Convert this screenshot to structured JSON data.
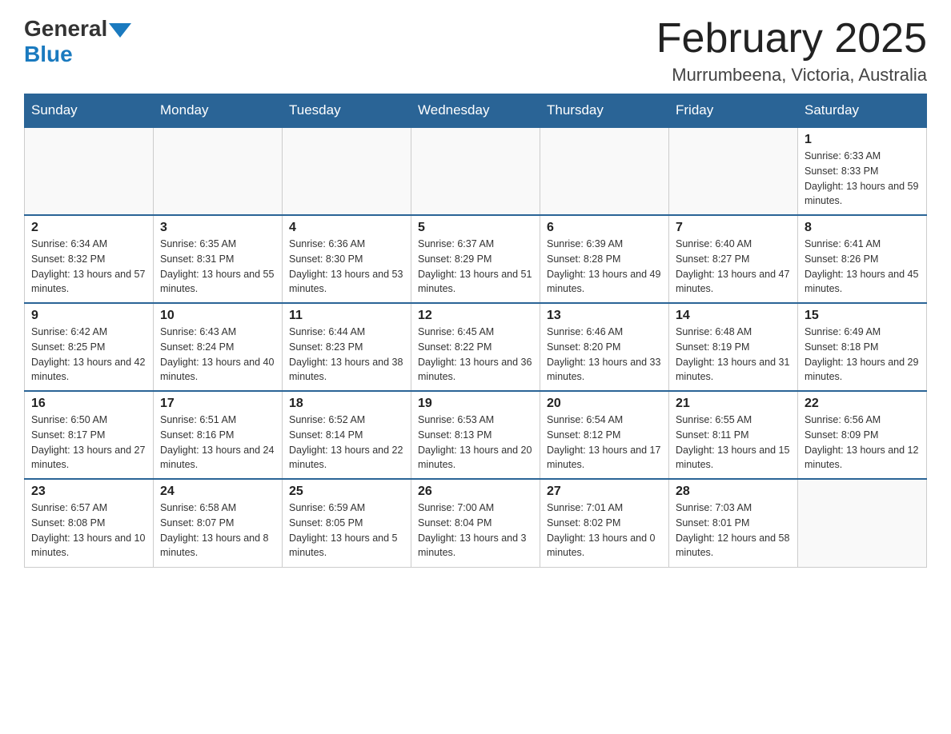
{
  "header": {
    "logo": {
      "general": "General",
      "blue": "Blue",
      "arrow_color": "#1a7abf"
    },
    "title": "February 2025",
    "location": "Murrumbeena, Victoria, Australia"
  },
  "calendar": {
    "days_of_week": [
      "Sunday",
      "Monday",
      "Tuesday",
      "Wednesday",
      "Thursday",
      "Friday",
      "Saturday"
    ],
    "weeks": [
      [
        {
          "day": "",
          "info": ""
        },
        {
          "day": "",
          "info": ""
        },
        {
          "day": "",
          "info": ""
        },
        {
          "day": "",
          "info": ""
        },
        {
          "day": "",
          "info": ""
        },
        {
          "day": "",
          "info": ""
        },
        {
          "day": "1",
          "info": "Sunrise: 6:33 AM\nSunset: 8:33 PM\nDaylight: 13 hours and 59 minutes."
        }
      ],
      [
        {
          "day": "2",
          "info": "Sunrise: 6:34 AM\nSunset: 8:32 PM\nDaylight: 13 hours and 57 minutes."
        },
        {
          "day": "3",
          "info": "Sunrise: 6:35 AM\nSunset: 8:31 PM\nDaylight: 13 hours and 55 minutes."
        },
        {
          "day": "4",
          "info": "Sunrise: 6:36 AM\nSunset: 8:30 PM\nDaylight: 13 hours and 53 minutes."
        },
        {
          "day": "5",
          "info": "Sunrise: 6:37 AM\nSunset: 8:29 PM\nDaylight: 13 hours and 51 minutes."
        },
        {
          "day": "6",
          "info": "Sunrise: 6:39 AM\nSunset: 8:28 PM\nDaylight: 13 hours and 49 minutes."
        },
        {
          "day": "7",
          "info": "Sunrise: 6:40 AM\nSunset: 8:27 PM\nDaylight: 13 hours and 47 minutes."
        },
        {
          "day": "8",
          "info": "Sunrise: 6:41 AM\nSunset: 8:26 PM\nDaylight: 13 hours and 45 minutes."
        }
      ],
      [
        {
          "day": "9",
          "info": "Sunrise: 6:42 AM\nSunset: 8:25 PM\nDaylight: 13 hours and 42 minutes."
        },
        {
          "day": "10",
          "info": "Sunrise: 6:43 AM\nSunset: 8:24 PM\nDaylight: 13 hours and 40 minutes."
        },
        {
          "day": "11",
          "info": "Sunrise: 6:44 AM\nSunset: 8:23 PM\nDaylight: 13 hours and 38 minutes."
        },
        {
          "day": "12",
          "info": "Sunrise: 6:45 AM\nSunset: 8:22 PM\nDaylight: 13 hours and 36 minutes."
        },
        {
          "day": "13",
          "info": "Sunrise: 6:46 AM\nSunset: 8:20 PM\nDaylight: 13 hours and 33 minutes."
        },
        {
          "day": "14",
          "info": "Sunrise: 6:48 AM\nSunset: 8:19 PM\nDaylight: 13 hours and 31 minutes."
        },
        {
          "day": "15",
          "info": "Sunrise: 6:49 AM\nSunset: 8:18 PM\nDaylight: 13 hours and 29 minutes."
        }
      ],
      [
        {
          "day": "16",
          "info": "Sunrise: 6:50 AM\nSunset: 8:17 PM\nDaylight: 13 hours and 27 minutes."
        },
        {
          "day": "17",
          "info": "Sunrise: 6:51 AM\nSunset: 8:16 PM\nDaylight: 13 hours and 24 minutes."
        },
        {
          "day": "18",
          "info": "Sunrise: 6:52 AM\nSunset: 8:14 PM\nDaylight: 13 hours and 22 minutes."
        },
        {
          "day": "19",
          "info": "Sunrise: 6:53 AM\nSunset: 8:13 PM\nDaylight: 13 hours and 20 minutes."
        },
        {
          "day": "20",
          "info": "Sunrise: 6:54 AM\nSunset: 8:12 PM\nDaylight: 13 hours and 17 minutes."
        },
        {
          "day": "21",
          "info": "Sunrise: 6:55 AM\nSunset: 8:11 PM\nDaylight: 13 hours and 15 minutes."
        },
        {
          "day": "22",
          "info": "Sunrise: 6:56 AM\nSunset: 8:09 PM\nDaylight: 13 hours and 12 minutes."
        }
      ],
      [
        {
          "day": "23",
          "info": "Sunrise: 6:57 AM\nSunset: 8:08 PM\nDaylight: 13 hours and 10 minutes."
        },
        {
          "day": "24",
          "info": "Sunrise: 6:58 AM\nSunset: 8:07 PM\nDaylight: 13 hours and 8 minutes."
        },
        {
          "day": "25",
          "info": "Sunrise: 6:59 AM\nSunset: 8:05 PM\nDaylight: 13 hours and 5 minutes."
        },
        {
          "day": "26",
          "info": "Sunrise: 7:00 AM\nSunset: 8:04 PM\nDaylight: 13 hours and 3 minutes."
        },
        {
          "day": "27",
          "info": "Sunrise: 7:01 AM\nSunset: 8:02 PM\nDaylight: 13 hours and 0 minutes."
        },
        {
          "day": "28",
          "info": "Sunrise: 7:03 AM\nSunset: 8:01 PM\nDaylight: 12 hours and 58 minutes."
        },
        {
          "day": "",
          "info": ""
        }
      ]
    ]
  }
}
